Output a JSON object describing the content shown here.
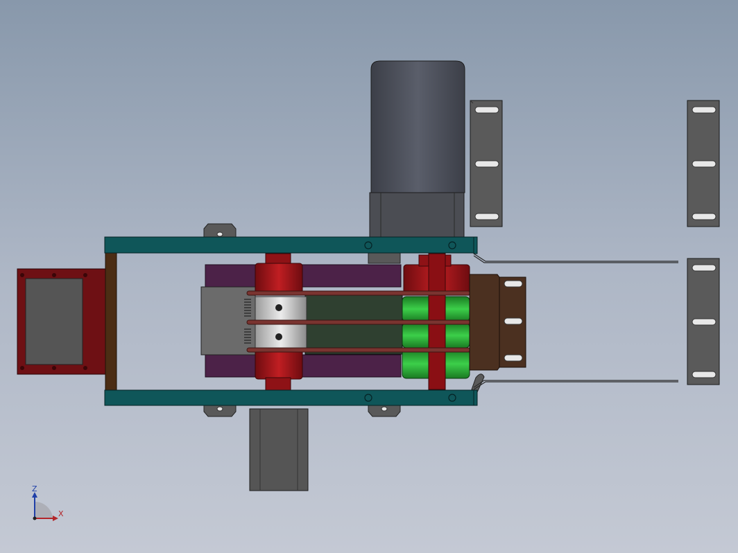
{
  "viewport": {
    "background_top": "#8898ab",
    "background_bottom": "#c4c9d4"
  },
  "triad": {
    "z_label": "Z",
    "x_label": "X",
    "z_color": "#1f3fa8",
    "x_color": "#b3262a"
  },
  "palette": {
    "frame_teal": "#0f5659",
    "dark_red": "#7a0f12",
    "roller_red": "#9e1418",
    "purple": "#4c2248",
    "green_roller": "#1e9a2a",
    "belt_green": "#2f4030",
    "motor_grey": "#4a4e58",
    "part_grey": "#5a5a5a",
    "brown": "#4b3020"
  }
}
